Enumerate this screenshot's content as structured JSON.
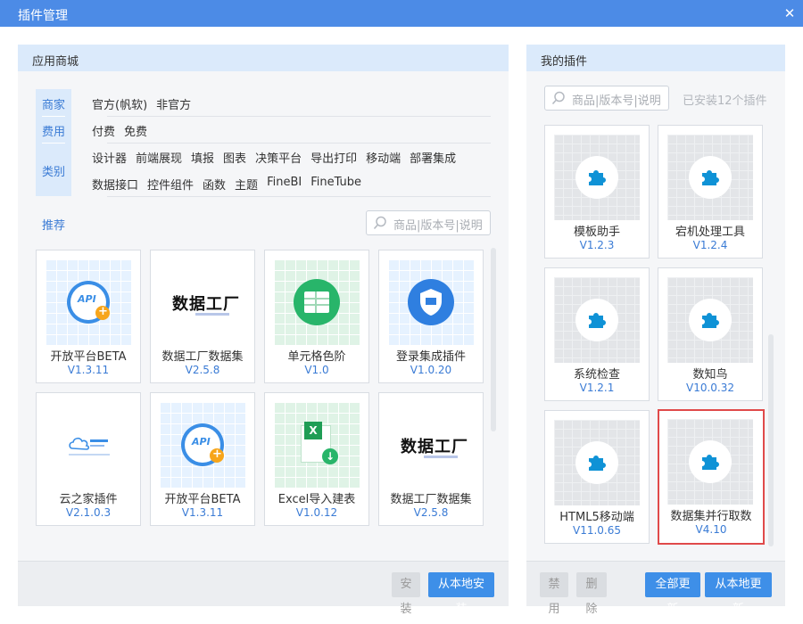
{
  "window": {
    "title": "插件管理",
    "close_glyph": "✕"
  },
  "store": {
    "header": "应用商城",
    "facets": [
      "商家",
      "费用",
      "类别"
    ],
    "merchant_options": [
      "官方(帆软)",
      "非官方"
    ],
    "fee_options": [
      "付费",
      "免费"
    ],
    "category_row1": [
      "设计器",
      "前端展现",
      "填报",
      "图表",
      "决策平台",
      "导出打印",
      "移动端",
      "部署集成"
    ],
    "category_row2": [
      "数据接口",
      "控件组件",
      "函数",
      "主题",
      "FineBI",
      "FineTube"
    ],
    "recommend_label": "推荐",
    "search_placeholder": "商品|版本号|说明",
    "cards": [
      {
        "name": "开放平台BETA",
        "version": "V1.3.11",
        "thumb": "api-icon"
      },
      {
        "name": "数据工厂数据集",
        "version": "V2.5.8",
        "thumb": "data-factory-logo",
        "logo_text": "数据工厂"
      },
      {
        "name": "单元格色阶",
        "version": "V1.0",
        "thumb": "table-icon"
      },
      {
        "name": "登录集成插件",
        "version": "V1.0.20",
        "thumb": "shield-icon"
      },
      {
        "name": "云之家插件",
        "version": "V2.1.0.3",
        "thumb": "cloud-logo"
      },
      {
        "name": "开放平台BETA",
        "version": "V1.3.11",
        "thumb": "api-icon"
      },
      {
        "name": "Excel导入建表",
        "version": "V1.0.12",
        "thumb": "excel-icon"
      },
      {
        "name": "数据工厂数据集",
        "version": "V2.5.8",
        "thumb": "data-factory-logo",
        "logo_text": "数据工厂"
      }
    ],
    "buttons": {
      "install": "安装",
      "install_local": "从本地安装"
    }
  },
  "mine": {
    "header": "我的插件",
    "search_placeholder": "商品|版本号|说明",
    "installed_text": "已安装12个插件",
    "cards": [
      {
        "name": "模板助手",
        "version": "V1.2.3",
        "thumb": "puzzle-icon"
      },
      {
        "name": "宕机处理工具",
        "version": "V1.2.4",
        "thumb": "puzzle-icon"
      },
      {
        "name": "系统检查",
        "version": "V1.2.1",
        "thumb": "puzzle-icon"
      },
      {
        "name": "数知鸟",
        "version": "V10.0.32",
        "thumb": "puzzle-icon"
      },
      {
        "name": "HTML5移动端",
        "version": "V11.0.65",
        "thumb": "puzzle-icon"
      },
      {
        "name": "数据集并行取数",
        "version": "V4.10",
        "thumb": "puzzle-icon",
        "selected": true
      }
    ],
    "buttons": {
      "disable": "禁用",
      "delete": "删除",
      "update_all": "全部更新",
      "update_local": "从本地更新"
    }
  },
  "colors": {
    "accent": "#3e8fe8",
    "titlebar": "#4c8be6",
    "panel_header": "#dbeafb",
    "puzzle": "#0f92d6",
    "selected_border": "#e04a4a"
  }
}
